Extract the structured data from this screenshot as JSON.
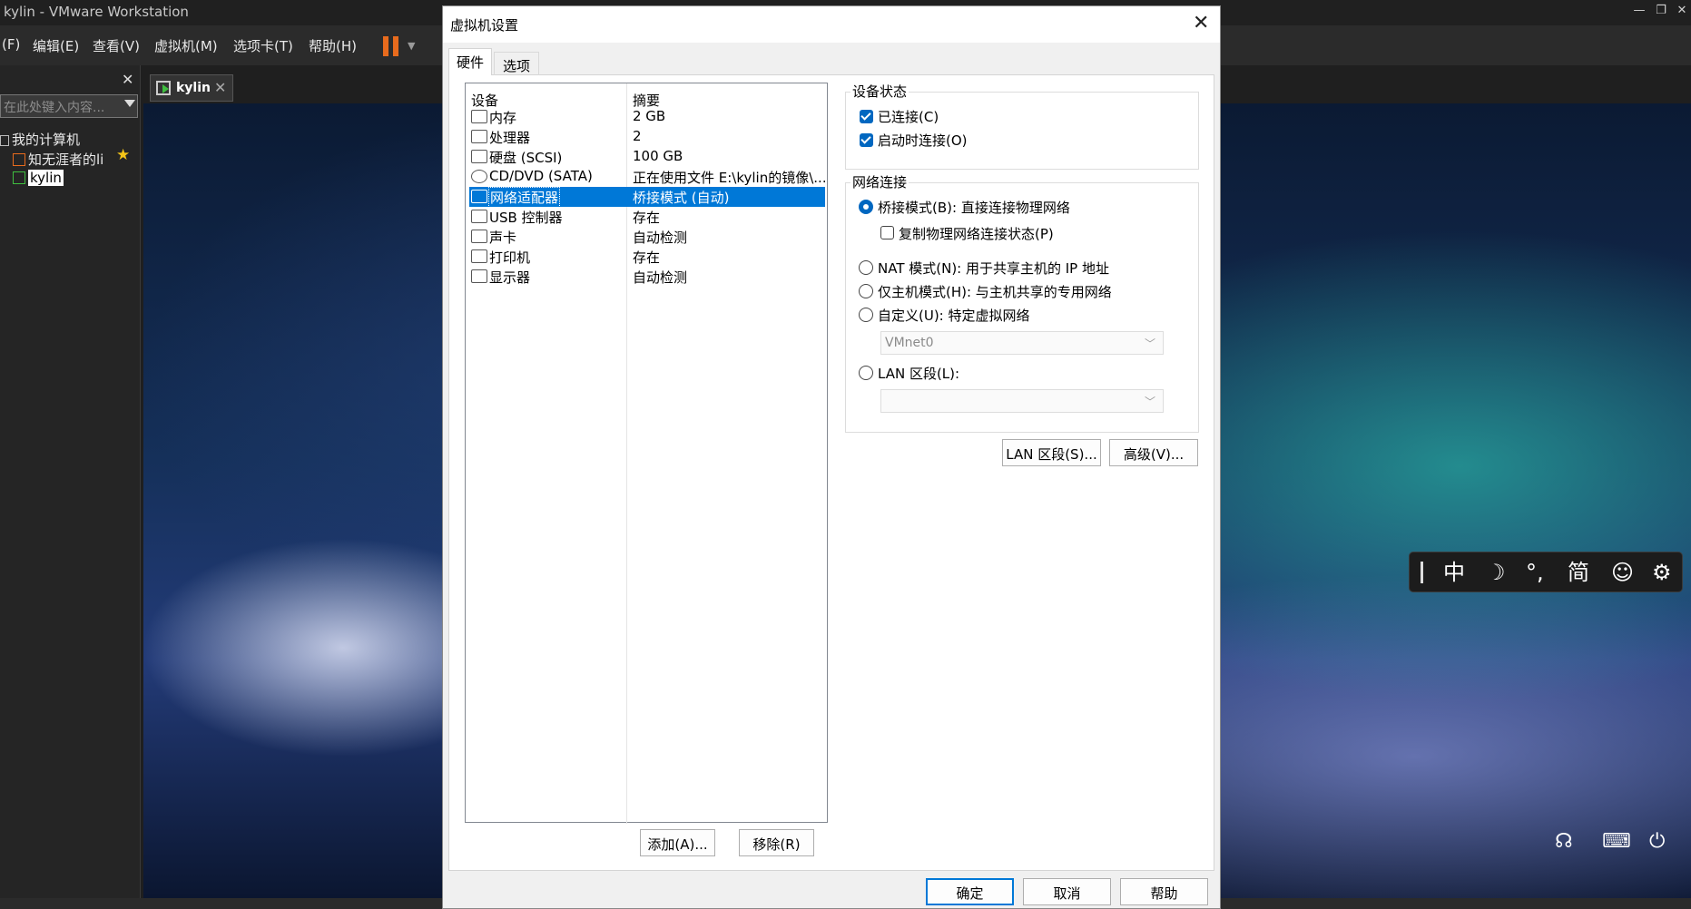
{
  "app": {
    "title": "kylin - VMware Workstation",
    "window_controls": {
      "minimize": "—",
      "restore": "❐",
      "close": "✕"
    }
  },
  "menubar": {
    "items": [
      "(F)",
      "编辑(E)",
      "查看(V)",
      "虚拟机(M)",
      "选项卡(T)",
      "帮助(H)"
    ],
    "accent": "#e86b1d"
  },
  "sidebar": {
    "close": "✕",
    "search_placeholder": "在此处键入内容...",
    "tree": [
      {
        "label": "我的计算机"
      },
      {
        "label": "知无涯者的li"
      },
      {
        "label": "kylin"
      }
    ],
    "star": "★"
  },
  "tab": {
    "label": "kylin",
    "close": "✕"
  },
  "dialog": {
    "title": "虚拟机设置",
    "close": "✕",
    "tabs": [
      "硬件",
      "选项"
    ],
    "device_list": {
      "columns": [
        "设备",
        "摘要"
      ],
      "rows": [
        {
          "name": "内存",
          "summary": "2 GB",
          "icon": "memory-icon"
        },
        {
          "name": "处理器",
          "summary": "2",
          "icon": "cpu-icon"
        },
        {
          "name": "硬盘 (SCSI)",
          "summary": "100 GB",
          "icon": "hard-disk-icon"
        },
        {
          "name": "CD/DVD (SATA)",
          "summary": "正在使用文件 E:\\kylin的镜像\\...",
          "icon": "cd-icon"
        },
        {
          "name": "网络适配器",
          "summary": "桥接模式 (自动)",
          "icon": "network-icon"
        },
        {
          "name": "USB 控制器",
          "summary": "存在",
          "icon": "usb-icon"
        },
        {
          "name": "声卡",
          "summary": "自动检测",
          "icon": "speaker-icon"
        },
        {
          "name": "打印机",
          "summary": "存在",
          "icon": "printer-icon"
        },
        {
          "name": "显示器",
          "summary": "自动检测",
          "icon": "monitor-icon"
        }
      ],
      "selected_index": 4
    },
    "add_button": "添加(A)...",
    "remove_button": "移除(R)",
    "device_status": {
      "title": "设备状态",
      "connected": "已连接(C)",
      "connect_at_power_on": "启动时连接(O)"
    },
    "network": {
      "title": "网络连接",
      "bridged": "桥接模式(B): 直接连接物理网络",
      "replicate": "复制物理网络连接状态(P)",
      "nat": "NAT 模式(N): 用于共享主机的 IP 地址",
      "host_only": "仅主机模式(H): 与主机共享的专用网络",
      "custom": "自定义(U): 特定虚拟网络",
      "custom_select": "VMnet0",
      "lan_segment": "LAN 区段(L):",
      "lan_select": ""
    },
    "lan_segments_button": "LAN 区段(S)...",
    "advanced_button": "高级(V)...",
    "ok_button": "确定",
    "cancel_button": "取消",
    "help_button": "帮助",
    "accent": "#0078d7"
  },
  "ime": {
    "items": [
      "中",
      "☽",
      "°,",
      "简",
      "☺",
      "⚙"
    ]
  },
  "tray": {
    "icons": [
      "user-switch-icon",
      "keyboard-icon",
      "power-icon"
    ]
  }
}
